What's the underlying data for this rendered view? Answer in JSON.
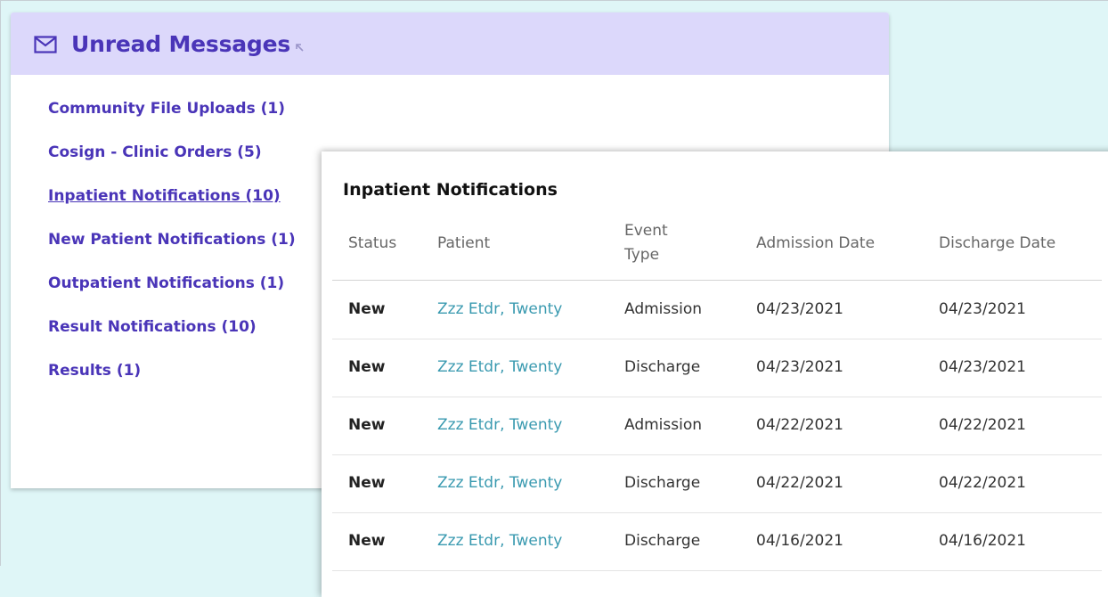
{
  "messages_panel": {
    "title": "Unread Messages",
    "items": [
      {
        "label": "Community File Uploads (1)"
      },
      {
        "label": "Cosign - Clinic Orders (5)"
      },
      {
        "label": "Inpatient Notifications (10)"
      },
      {
        "label": "New Patient Notifications (1)"
      },
      {
        "label": "Outpatient Notifications (1)"
      },
      {
        "label": "Result Notifications (10)"
      },
      {
        "label": "Results (1)"
      }
    ]
  },
  "popup": {
    "title": "Inpatient Notifications",
    "columns": {
      "status": "Status",
      "patient": "Patient",
      "event_type_line1": "Event",
      "event_type_line2": "Type",
      "admission": "Admission Date",
      "discharge": "Discharge Date"
    },
    "rows": [
      {
        "status": "New",
        "patient": "Zzz Etdr, Twenty",
        "event": "Admission",
        "admission": "04/23/2021",
        "discharge": "04/23/2021"
      },
      {
        "status": "New",
        "patient": "Zzz Etdr, Twenty",
        "event": "Discharge",
        "admission": "04/23/2021",
        "discharge": "04/23/2021"
      },
      {
        "status": "New",
        "patient": "Zzz Etdr, Twenty",
        "event": "Admission",
        "admission": "04/22/2021",
        "discharge": "04/22/2021"
      },
      {
        "status": "New",
        "patient": "Zzz Etdr, Twenty",
        "event": "Discharge",
        "admission": "04/22/2021",
        "discharge": "04/22/2021"
      },
      {
        "status": "New",
        "patient": "Zzz Etdr, Twenty",
        "event": "Discharge",
        "admission": "04/16/2021",
        "discharge": "04/16/2021"
      }
    ]
  },
  "colors": {
    "accent": "#4a35b8",
    "header_bg": "#dcd8fb",
    "page_bg": "#dff6f7",
    "link": "#3a9ab0"
  },
  "icons": {
    "header": "envelope-icon",
    "expand": "expand-arrow-icon"
  }
}
